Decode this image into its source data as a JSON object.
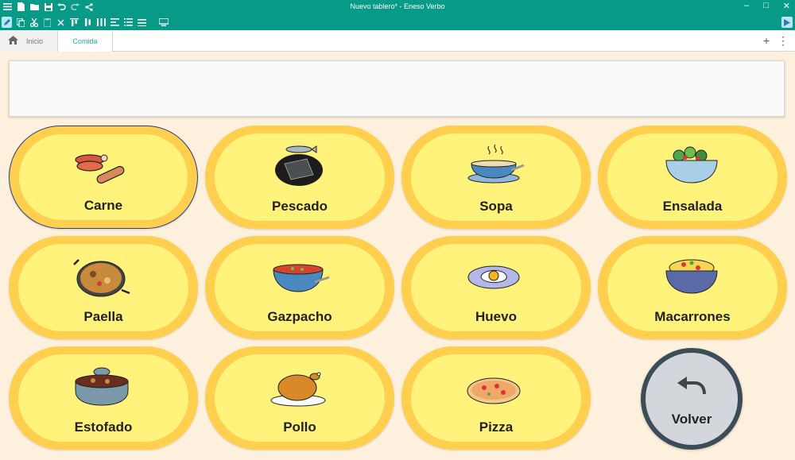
{
  "window": {
    "title": "Nuevo tablero* - Eneso Verbo",
    "controls": [
      "–",
      "□",
      "✕"
    ]
  },
  "tabs": {
    "home": "Inicio",
    "current": "Comida"
  },
  "sentence_bar": {
    "text": ""
  },
  "cells": [
    {
      "label": "Carne",
      "icon": "meat-icon"
    },
    {
      "label": "Pescado",
      "icon": "fish-icon"
    },
    {
      "label": "Sopa",
      "icon": "soup-icon"
    },
    {
      "label": "Ensalada",
      "icon": "salad-icon"
    },
    {
      "label": "Paella",
      "icon": "paella-icon"
    },
    {
      "label": "Gazpacho",
      "icon": "gazpacho-icon"
    },
    {
      "label": "Huevo",
      "icon": "egg-icon"
    },
    {
      "label": "Macarrones",
      "icon": "macaroni-icon"
    },
    {
      "label": "Estofado",
      "icon": "stew-icon"
    },
    {
      "label": "Pollo",
      "icon": "chicken-icon"
    },
    {
      "label": "Pizza",
      "icon": "pizza-icon"
    }
  ],
  "back_button": {
    "label": "Volver",
    "icon": "undo-arrow-icon"
  },
  "colors": {
    "titlebar": "#079a87",
    "background": "#fdf0dc",
    "cell_outer": "#ffcf4d",
    "cell_inner": "#fff37b",
    "back_button": "#d3d6da",
    "back_border": "#3c4d57",
    "selection": "#2a3f8c"
  }
}
